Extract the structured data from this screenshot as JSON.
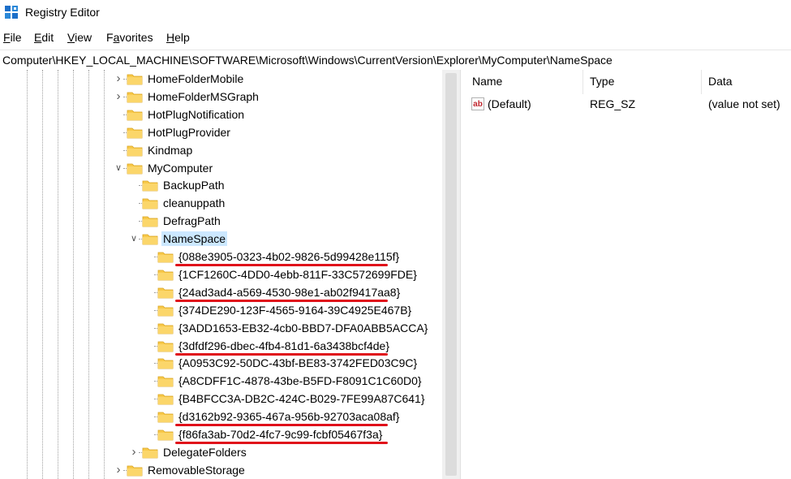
{
  "window": {
    "title": "Registry Editor",
    "icon": "registry-editor-icon"
  },
  "menu": [
    {
      "acc": "F",
      "rest": "ile"
    },
    {
      "acc": "E",
      "rest": "dit"
    },
    {
      "acc": "V",
      "rest": "iew"
    },
    {
      "acc": "",
      "pre": "F",
      "mid": "a",
      "rest": "vorites"
    },
    {
      "acc": "H",
      "rest": "elp"
    }
  ],
  "address": "Computer\\HKEY_LOCAL_MACHINE\\SOFTWARE\\Microsoft\\Windows\\CurrentVersion\\Explorer\\MyComputer\\NameSpace",
  "tree": {
    "nodes": [
      {
        "label": "HomeFolderMobile",
        "expander": "collapsed"
      },
      {
        "label": "HomeFolderMSGraph",
        "expander": "collapsed"
      },
      {
        "label": "HotPlugNotification",
        "expander": "none"
      },
      {
        "label": "HotPlugProvider",
        "expander": "none"
      },
      {
        "label": "Kindmap",
        "expander": "none"
      },
      {
        "label": "MyComputer",
        "expander": "expanded"
      },
      {
        "label": "BackupPath",
        "expander": "none"
      },
      {
        "label": "cleanuppath",
        "expander": "none"
      },
      {
        "label": "DefragPath",
        "expander": "none"
      },
      {
        "label": "NameSpace",
        "expander": "expanded",
        "selected": true
      },
      {
        "label": "{088e3905-0323-4b02-9826-5d99428e115f}",
        "expander": "none",
        "marked": true
      },
      {
        "label": "{1CF1260C-4DD0-4ebb-811F-33C572699FDE}",
        "expander": "none"
      },
      {
        "label": "{24ad3ad4-a569-4530-98e1-ab02f9417aa8}",
        "expander": "none",
        "marked": true
      },
      {
        "label": "{374DE290-123F-4565-9164-39C4925E467B}",
        "expander": "none"
      },
      {
        "label": "{3ADD1653-EB32-4cb0-BBD7-DFA0ABB5ACCA}",
        "expander": "none"
      },
      {
        "label": "{3dfdf296-dbec-4fb4-81d1-6a3438bcf4de}",
        "expander": "none",
        "marked": true
      },
      {
        "label": "{A0953C92-50DC-43bf-BE83-3742FED03C9C}",
        "expander": "none"
      },
      {
        "label": "{A8CDFF1C-4878-43be-B5FD-F8091C1C60D0}",
        "expander": "none"
      },
      {
        "label": "{B4BFCC3A-DB2C-424C-B029-7FE99A87C641}",
        "expander": "none"
      },
      {
        "label": "{d3162b92-9365-467a-956b-92703aca08af}",
        "expander": "none",
        "marked": true
      },
      {
        "label": "{f86fa3ab-70d2-4fc7-9c99-fcbf05467f3a}",
        "expander": "none",
        "marked": true
      },
      {
        "label": "DelegateFolders",
        "expander": "collapsed"
      },
      {
        "label": "RemovableStorage",
        "expander": "collapsed"
      }
    ]
  },
  "list": {
    "columns": [
      "Name",
      "Type",
      "Data"
    ],
    "rows": [
      {
        "name": "(Default)",
        "type": "REG_SZ",
        "data": "(value not set)",
        "icon": "string-value-icon"
      }
    ]
  },
  "colors": {
    "selection": "#cce8ff",
    "folder": "#f8c94a",
    "annotation": "#e0101a"
  }
}
